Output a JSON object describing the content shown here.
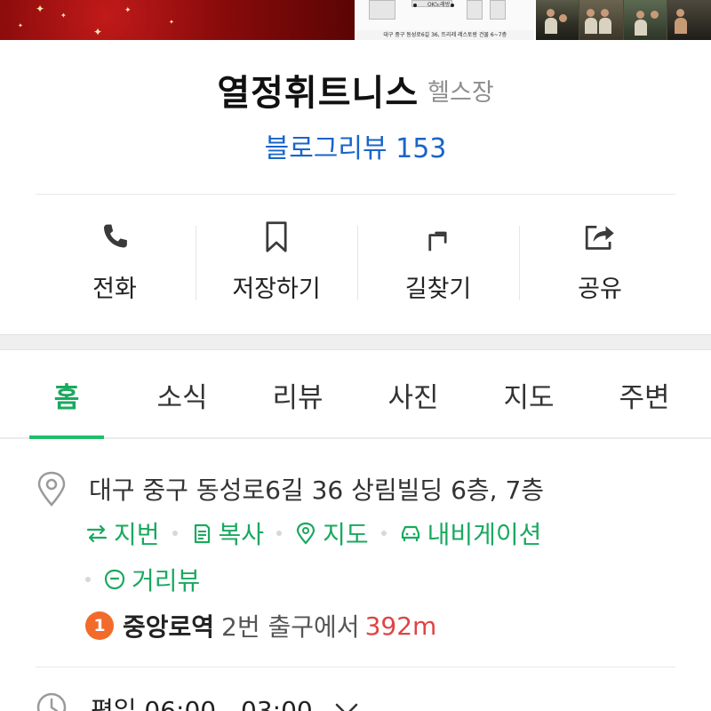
{
  "place": {
    "name": "열정휘트니스",
    "category": "헬스장",
    "review_link": "블로그리뷰 153"
  },
  "photos": {
    "map_label": "OK노래방",
    "map_caption": "대구 중구 동성로6길 36, 뜨리레 레스토랑 건물 6~7층"
  },
  "actions": [
    {
      "label": "전화",
      "icon": "phone-icon"
    },
    {
      "label": "저장하기",
      "icon": "bookmark-icon"
    },
    {
      "label": "길찾기",
      "icon": "directions-icon"
    },
    {
      "label": "공유",
      "icon": "share-icon"
    }
  ],
  "tabs": [
    {
      "label": "홈",
      "active": true
    },
    {
      "label": "소식",
      "active": false
    },
    {
      "label": "리뷰",
      "active": false
    },
    {
      "label": "사진",
      "active": false
    },
    {
      "label": "지도",
      "active": false
    },
    {
      "label": "주변",
      "active": false
    }
  ],
  "address": {
    "text": "대구 중구 동성로6길 36 상림빌딩 6층, 7층",
    "links": [
      {
        "label": "지번",
        "icon": "swap-icon"
      },
      {
        "label": "복사",
        "icon": "copy-icon"
      },
      {
        "label": "지도",
        "icon": "map-pin-icon"
      },
      {
        "label": "내비게이션",
        "icon": "car-icon"
      },
      {
        "label": "거리뷰",
        "icon": "street-view-icon"
      }
    ]
  },
  "subway": {
    "line": "1",
    "station": "중앙로역",
    "exit": "2번 출구에서",
    "distance": "392m"
  },
  "hours": {
    "text": "평일 06:00 - 03:00"
  },
  "colors": {
    "accent_green": "#1aa95f",
    "link_blue": "#1a64c8",
    "line1_orange": "#f26b2a",
    "distance_red": "#e04343"
  }
}
